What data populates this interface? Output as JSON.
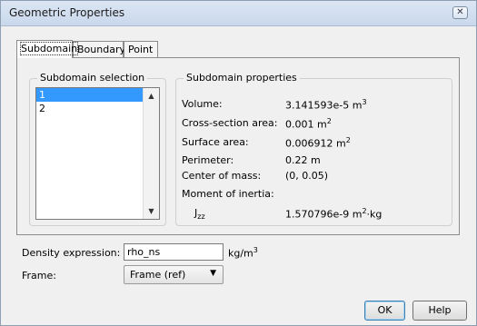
{
  "window": {
    "title": "Geometric Properties",
    "close_glyph": "✕"
  },
  "tabs": [
    {
      "label": "Subdomain",
      "active": true
    },
    {
      "label": "Boundary",
      "active": false
    },
    {
      "label": "Point",
      "active": false
    }
  ],
  "selection": {
    "group_label": "Subdomain selection",
    "items": [
      "1",
      "2"
    ],
    "selected_index": 0
  },
  "properties": {
    "group_label": "Subdomain properties",
    "volume": {
      "label": "Volume:",
      "value": "3.141593e-5 m",
      "exp": "3"
    },
    "cross_section": {
      "label": "Cross-section area:",
      "value": "0.001 m",
      "exp": "2"
    },
    "surface": {
      "label": "Surface area:",
      "value": "0.006912 m",
      "exp": "2"
    },
    "perimeter": {
      "label": "Perimeter:",
      "value": "0.22 m"
    },
    "center_of_mass": {
      "label": "Center of mass:",
      "value": "(0, 0.05)"
    },
    "moment": {
      "label": "Moment of inertia:"
    },
    "jzz": {
      "label": "J",
      "sub": "zz",
      "value": "1.570796e-9 m",
      "exp": "2",
      "tail": "·kg"
    }
  },
  "density": {
    "label": "Density expression:",
    "value": "rho_ns",
    "unit": "kg/m",
    "unit_exp": "3"
  },
  "frame": {
    "label": "Frame:",
    "value": "Frame (ref)"
  },
  "buttons": {
    "ok": "OK",
    "help": "Help"
  },
  "icons": {
    "close": "close-icon",
    "scroll_up": "scroll-up-icon",
    "scroll_down": "scroll-down-icon",
    "dropdown": "chevron-down-icon"
  },
  "colors": {
    "selection": "#3399ff",
    "titlebar": "#c9d8ec"
  }
}
